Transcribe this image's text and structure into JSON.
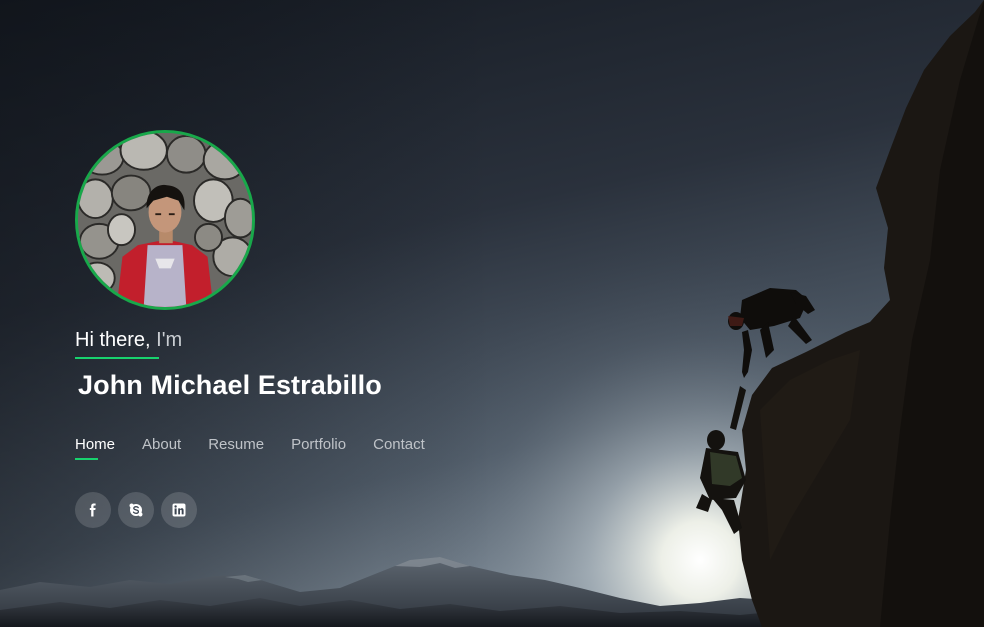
{
  "hero": {
    "greeting_main": "Hi there,",
    "greeting_dim": "I'm",
    "name": "John Michael Estrabillo"
  },
  "nav": {
    "active": "Home",
    "items": [
      "Home",
      "About",
      "Resume",
      "Portfolio",
      "Contact"
    ]
  },
  "socials": [
    {
      "icon": "facebook-icon"
    },
    {
      "icon": "skype-icon"
    },
    {
      "icon": "linkedin-icon"
    }
  ],
  "colors": {
    "accent": "#18d26e",
    "avatar_border": "#18a84a",
    "sky_dark": "#14181f",
    "sky_glow": "#f4f6ee"
  }
}
